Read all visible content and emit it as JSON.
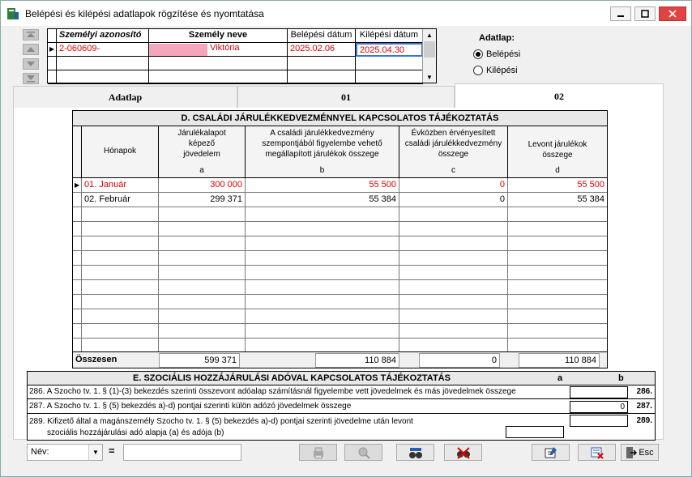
{
  "window": {
    "title": "Belépési és kilépési adatlapok rögzítése és nyomtatása"
  },
  "person_grid": {
    "headers": [
      "Személyi azonosító",
      "Személy neve",
      "Belépési dátum",
      "Kilépési dátum"
    ],
    "rows": [
      {
        "id": "2-060609-",
        "name": "Viktória",
        "entry": "2025.02.06",
        "exit": "2025.04.30"
      }
    ]
  },
  "adatlap": {
    "label": "Adatlap:",
    "options": [
      "Belépési",
      "Kilépési"
    ],
    "selected": "Belépési"
  },
  "tabs": {
    "items": [
      "Adatlap",
      "01",
      "02"
    ],
    "active": "02"
  },
  "section_d": {
    "title": "D. CSALÁDI JÁRULÉKKEDVEZMÉNNYEL KAPCSOLATOS TÁJÉKOZTATÁS",
    "col_month": "Hónapok",
    "col_a": "Járulékalapot képező jövedelem",
    "col_a_letter": "a",
    "col_b": "A családi járulékkedvezmény szempontjából figyelembe vehető megállapított járulékok összege",
    "col_b_letter": "b",
    "col_c": "Évközben érvényesített családi járulékkedvezmény összege",
    "col_c_letter": "c",
    "col_d": "Levont járulékok összege",
    "col_d_letter": "d",
    "rows": [
      {
        "month": "01. Január",
        "a": "300 000",
        "b": "55 500",
        "c": "0",
        "d": "55 500"
      },
      {
        "month": "02. Február",
        "a": "299 371",
        "b": "55 384",
        "c": "0",
        "d": "55 384"
      }
    ],
    "total_label": "Összesen",
    "total": {
      "a": "599 371",
      "b": "110 884",
      "c": "0",
      "d": "110 884"
    }
  },
  "section_e": {
    "title": "E. SZOCIÁLIS HOZZÁJÁRULÁSI ADÓVAL KAPCSOLATOS TÁJÉKOZTATÁS",
    "col_a": "a",
    "col_b": "b",
    "rows": [
      {
        "text": "286. A Szocho tv. 1. § (1)-(3) bekezdés szerinti összevont adóalap számításnál figyelembe vett jövedelmek és más jövedelmek összege",
        "value": "",
        "num": "286."
      },
      {
        "text": "287. A Szocho tv. 1. § (5) bekezdés a)-d) pontjai szerinti külön adózó jövedelmek összege",
        "value": "0",
        "num": "287."
      },
      {
        "text": "289. Kifizető által a magánszemély Szocho tv. 1. § (5) bekezdés a)-d) pontjai szerinti jövedelme után levont",
        "text2": "szociális hozzájárulási adó alapja (a) és adója (b)",
        "value": "",
        "num": "289."
      }
    ]
  },
  "bottom": {
    "filter_field": "Név:",
    "equals": "=",
    "filter_value": "",
    "esc_label": "Esc"
  },
  "colors": {
    "selected_text": "#d00000",
    "highlight_pink": "#f4a6bd",
    "close_red": "#e04343"
  }
}
